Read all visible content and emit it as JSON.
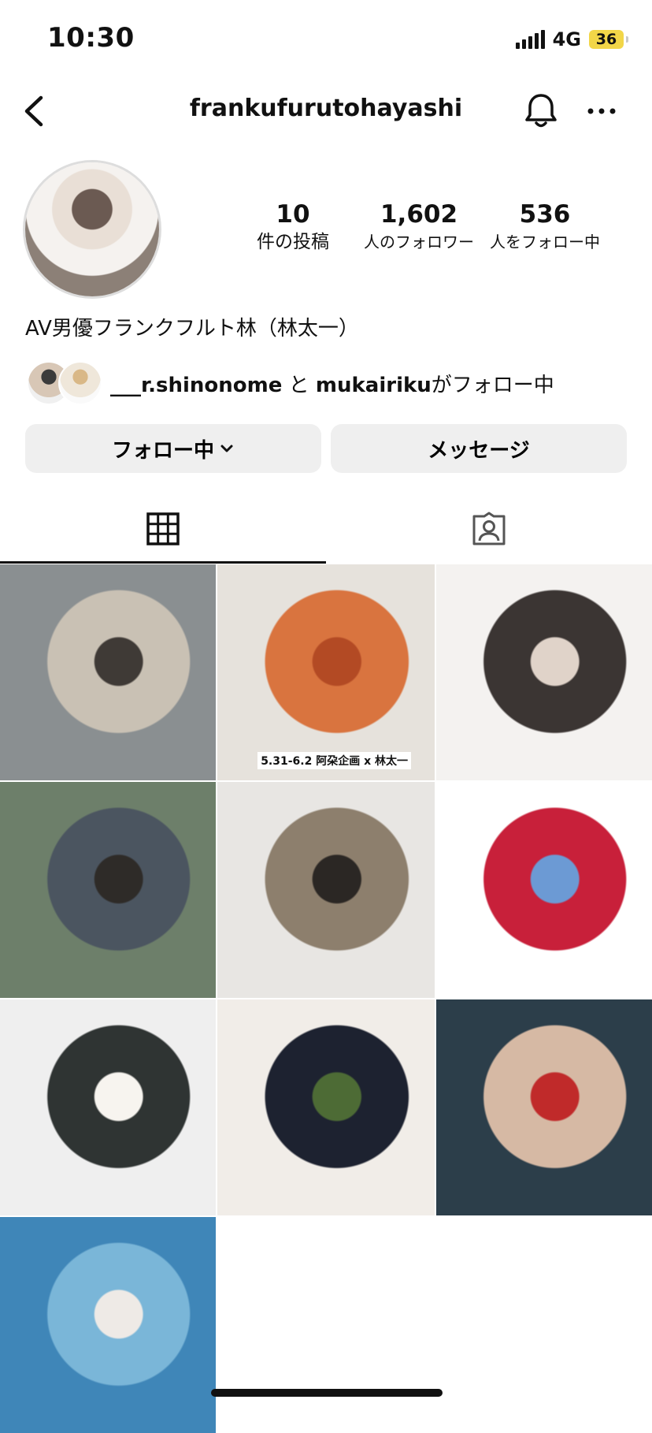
{
  "status_bar": {
    "time": "10:30",
    "network": "4G",
    "battery": "36"
  },
  "header": {
    "username": "frankufurutohayashi"
  },
  "profile": {
    "stats": [
      {
        "value": "10",
        "label": "件の投稿"
      },
      {
        "value": "1,602",
        "label": "人のフォロワー"
      },
      {
        "value": "536",
        "label": "人をフォロー中"
      }
    ],
    "bio": "AV男優フランクフルト林（林太一）",
    "mutual": {
      "user1": "___r.shinonome",
      "joiner": "と",
      "user2": "mukairiku",
      "suffix": "がフォロー中"
    }
  },
  "buttons": {
    "following": "フォロー中",
    "message": "メッセージ"
  },
  "posts": [
    {
      "colors": [
        "#8a8f91",
        "#c9c1b4",
        "#3f3a36"
      ],
      "caption": ""
    },
    {
      "colors": [
        "#e6e2dc",
        "#d9743f",
        "#b34a24"
      ],
      "caption": "5.31-6.2 阿朶企画 x 林太一"
    },
    {
      "colors": [
        "#f4f2f0",
        "#3b3533",
        "#e0d3c9"
      ],
      "caption": ""
    },
    {
      "colors": [
        "#6d7f6a",
        "#4b5560",
        "#2e2b28"
      ],
      "caption": ""
    },
    {
      "colors": [
        "#e8e6e3",
        "#8d7f6d",
        "#2b2724"
      ],
      "caption": ""
    },
    {
      "colors": [
        "#ffffff",
        "#c8203a",
        "#6c9ad4"
      ],
      "caption": ""
    },
    {
      "colors": [
        "#efefef",
        "#2f3433",
        "#f7f4ef"
      ],
      "caption": ""
    },
    {
      "colors": [
        "#f1ede8",
        "#1d2230",
        "#4d6b35"
      ],
      "caption": ""
    },
    {
      "colors": [
        "#2c3e4a",
        "#d6b9a4",
        "#c02a2a"
      ],
      "caption": ""
    },
    {
      "colors": [
        "#3f86b8",
        "#7ab6d8",
        "#eeeae6"
      ],
      "caption": ""
    }
  ]
}
